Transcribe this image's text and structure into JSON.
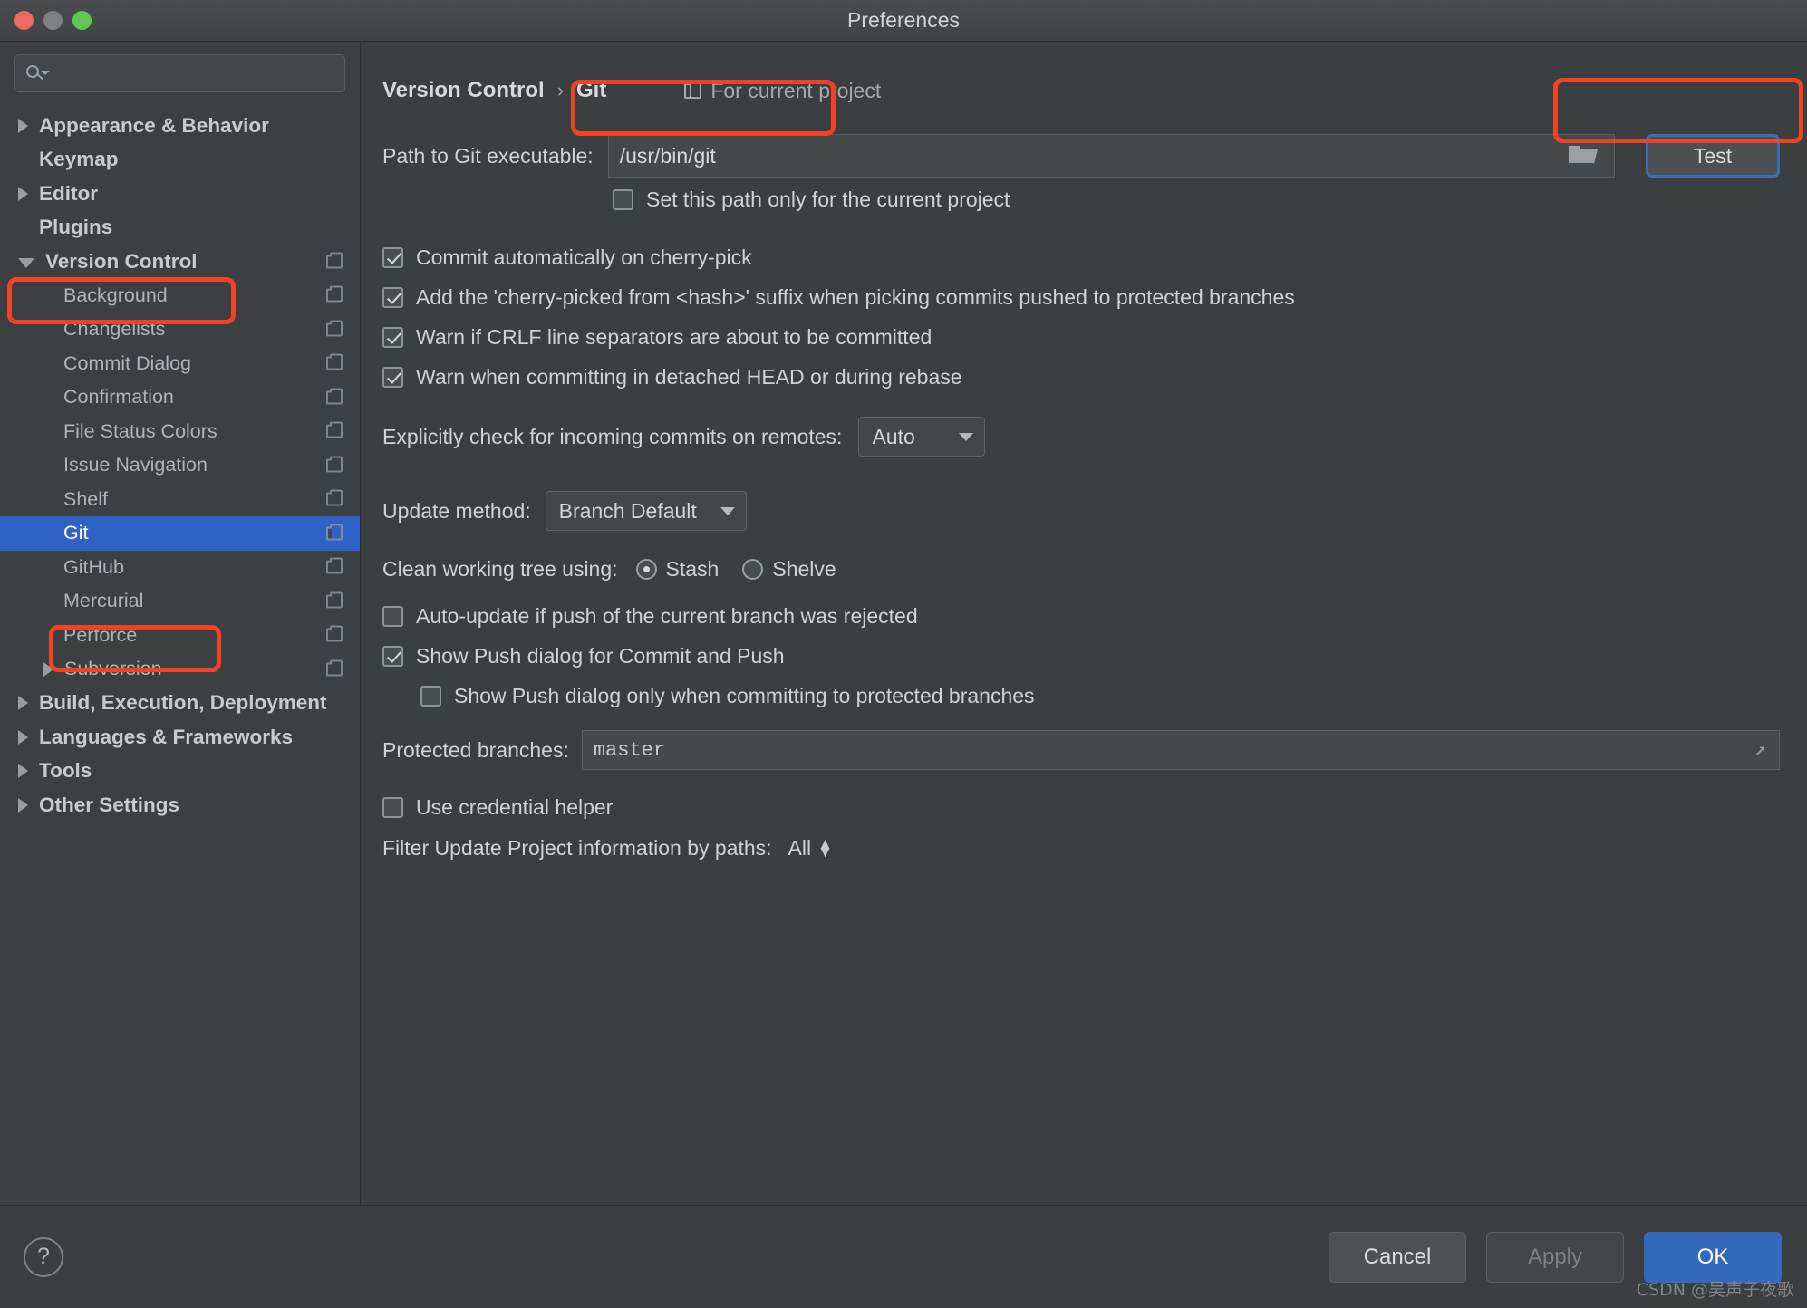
{
  "window": {
    "title": "Preferences",
    "traffic_lights": [
      "close-button",
      "minimize-button",
      "maximize-button"
    ]
  },
  "sidebar": {
    "search": {
      "placeholder": "",
      "value": "",
      "icon": "search-icon"
    },
    "items": [
      {
        "label": "Appearance & Behavior",
        "level": "top",
        "arrow": "right",
        "badge": false
      },
      {
        "label": "Keymap",
        "level": "top",
        "arrow": "none",
        "badge": false
      },
      {
        "label": "Editor",
        "level": "top",
        "arrow": "right",
        "badge": false
      },
      {
        "label": "Plugins",
        "level": "top",
        "arrow": "none",
        "badge": false
      },
      {
        "label": "Version Control",
        "level": "top",
        "arrow": "down",
        "badge": true
      },
      {
        "label": "Background",
        "level": "child",
        "arrow": "none",
        "badge": true
      },
      {
        "label": "Changelists",
        "level": "child",
        "arrow": "none",
        "badge": true
      },
      {
        "label": "Commit Dialog",
        "level": "child",
        "arrow": "none",
        "badge": true
      },
      {
        "label": "Confirmation",
        "level": "child",
        "arrow": "none",
        "badge": true
      },
      {
        "label": "File Status Colors",
        "level": "child",
        "arrow": "none",
        "badge": true
      },
      {
        "label": "Issue Navigation",
        "level": "child",
        "arrow": "none",
        "badge": true
      },
      {
        "label": "Shelf",
        "level": "child",
        "arrow": "none",
        "badge": true
      },
      {
        "label": "Git",
        "level": "child",
        "arrow": "none",
        "badge": true,
        "selected": true
      },
      {
        "label": "GitHub",
        "level": "child",
        "arrow": "none",
        "badge": true
      },
      {
        "label": "Mercurial",
        "level": "child",
        "arrow": "none",
        "badge": true
      },
      {
        "label": "Perforce",
        "level": "child",
        "arrow": "none",
        "badge": true
      },
      {
        "label": "Subversion",
        "level": "grandchild",
        "arrow": "right",
        "badge": true
      },
      {
        "label": "Build, Execution, Deployment",
        "level": "top",
        "arrow": "right",
        "badge": false
      },
      {
        "label": "Languages & Frameworks",
        "level": "top",
        "arrow": "right",
        "badge": false
      },
      {
        "label": "Tools",
        "level": "top",
        "arrow": "right",
        "badge": false
      },
      {
        "label": "Other Settings",
        "level": "top",
        "arrow": "right",
        "badge": false
      }
    ]
  },
  "main": {
    "breadcrumb": {
      "parent": "Version Control",
      "separator": "›",
      "current": "Git"
    },
    "scope": {
      "label": "For current project",
      "icon": "copy-settings-icon"
    },
    "path_row": {
      "label": "Path to Git executable:",
      "value": "/usr/bin/git",
      "placeholder": "",
      "browse_icon": "folder-icon",
      "test_button": "Test"
    },
    "set_path_only": {
      "label": "Set this path only for the current project",
      "checked": false
    },
    "checkboxes_group1": [
      {
        "label": "Commit automatically on cherry-pick",
        "checked": true
      },
      {
        "label": "Add the 'cherry-picked from <hash>' suffix when picking commits pushed to protected branches",
        "checked": true
      },
      {
        "label": "Warn if CRLF line separators are about to be committed",
        "checked": true
      },
      {
        "label": "Warn when committing in detached HEAD or during rebase",
        "checked": true
      }
    ],
    "incoming_commits": {
      "label": "Explicitly check for incoming commits on remotes:",
      "value": "Auto"
    },
    "update_method": {
      "label": "Update method:",
      "value": "Branch Default"
    },
    "clean_working_tree": {
      "label": "Clean working tree using:",
      "options": [
        {
          "label": "Stash",
          "selected": true
        },
        {
          "label": "Shelve",
          "selected": false
        }
      ]
    },
    "auto_update": {
      "label": "Auto-update if push of the current branch was rejected",
      "checked": false
    },
    "show_push_dialog": {
      "label": "Show Push dialog for Commit and Push",
      "checked": true
    },
    "show_push_dialog_protected": {
      "label": "Show Push dialog only when committing to protected branches",
      "checked": false
    },
    "protected_branches": {
      "label": "Protected branches:",
      "value": "master",
      "expand_icon": "expand-icon"
    },
    "use_credential_helper": {
      "label": "Use credential helper",
      "checked": false
    },
    "filter_update": {
      "label": "Filter Update Project information by paths:",
      "value": "All"
    }
  },
  "footer": {
    "help": "?",
    "cancel": "Cancel",
    "apply": "Apply",
    "ok": "OK"
  },
  "watermark": "CSDN @吴声子夜歌",
  "colors": {
    "annotation": "#f04323",
    "selection": "#2f62c4",
    "primary_button": "#3469bb",
    "focus_ring": "#3a6fb5"
  }
}
